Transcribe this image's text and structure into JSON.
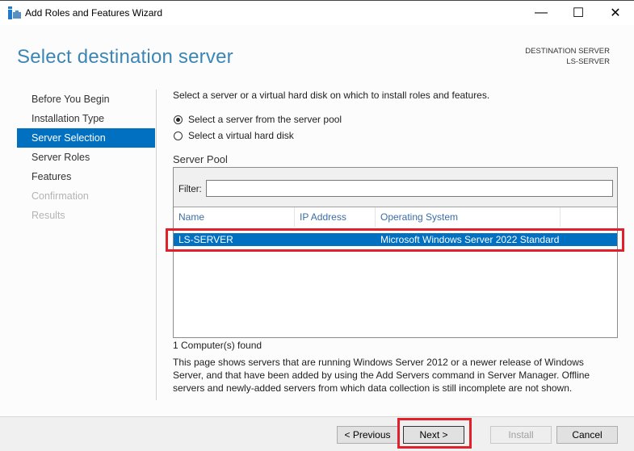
{
  "window": {
    "title": "Add Roles and Features Wizard",
    "minimize_glyph": "—",
    "maximize_glyph": "☐",
    "close_glyph": "✕"
  },
  "header": {
    "page_title": "Select destination server",
    "destination_label": "DESTINATION SERVER",
    "destination_value": "LS-SERVER"
  },
  "nav": {
    "items": [
      {
        "label": "Before You Begin",
        "state": "normal"
      },
      {
        "label": "Installation Type",
        "state": "normal"
      },
      {
        "label": "Server Selection",
        "state": "active"
      },
      {
        "label": "Server Roles",
        "state": "normal"
      },
      {
        "label": "Features",
        "state": "normal"
      },
      {
        "label": "Confirmation",
        "state": "disabled"
      },
      {
        "label": "Results",
        "state": "disabled"
      }
    ]
  },
  "main": {
    "intro": "Select a server or a virtual hard disk on which to install roles and features.",
    "radios": [
      {
        "label": "Select a server from the server pool",
        "checked": true
      },
      {
        "label": "Select a virtual hard disk",
        "checked": false
      }
    ],
    "pool_label": "Server Pool",
    "filter_label": "Filter:",
    "filter_value": "",
    "columns": [
      "Name",
      "IP Address",
      "Operating System"
    ],
    "rows": [
      {
        "name": "LS-SERVER",
        "ip": "",
        "os": "Microsoft Windows Server 2022 Standard",
        "selected": true
      }
    ],
    "found": "1 Computer(s) found",
    "description": "This page shows servers that are running Windows Server 2012 or a newer release of Windows Server, and that have been added by using the Add Servers command in Server Manager. Offline servers and newly-added servers from which data collection is still incomplete are not shown."
  },
  "footer": {
    "previous": "< Previous",
    "next": "Next >",
    "install": "Install",
    "cancel": "Cancel"
  },
  "colors": {
    "accent": "#0170c1",
    "title_blue": "#3b86b4",
    "highlight_red": "#e0202a"
  }
}
